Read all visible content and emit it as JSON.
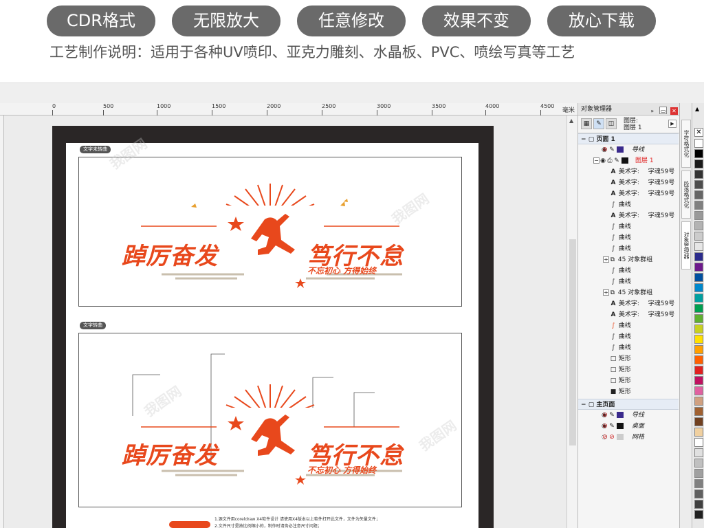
{
  "banner": {
    "pills": [
      "CDR格式",
      "无限放大",
      "任意修改",
      "效果不变",
      "放心下载"
    ],
    "craft_text": "工艺制作说明：适用于各种UV喷印、亚克力雕刻、水晶板、PVC、喷绘写真等工艺"
  },
  "ruler": {
    "ticks": [
      "0",
      "500",
      "1000",
      "1500",
      "2000",
      "2500",
      "3000",
      "3500",
      "4000",
      "4500"
    ],
    "unit": "毫米"
  },
  "canvas": {
    "tag_top": "文字未转曲",
    "tag_bottom": "文字转曲",
    "art": {
      "title_left": "踔厉奋发",
      "title_right": "笃行不怠",
      "subtitle": "不忘初心  方得始终"
    },
    "notes": [
      "1.源文件用coreldraw X4软件设计  请使用X4版本以上软件打开此文件，文件为矢量文件；",
      "2.文件尺寸是按比例缩小的，制作时请务必注意尺寸问题；"
    ]
  },
  "object_manager": {
    "title": "对象管理器",
    "layer_label": "图层:",
    "layer_value": "图层 1",
    "page1": "页面 1",
    "rows": [
      {
        "type": "layer",
        "name": "导线",
        "color": "#3a2a8c"
      },
      {
        "type": "layer",
        "name": "图层 1",
        "color": "#111111",
        "red": true
      },
      {
        "type": "text",
        "label": "美术字:",
        "value": "字魂59号"
      },
      {
        "type": "text",
        "label": "美术字:",
        "value": "字魂59号"
      },
      {
        "type": "text",
        "label": "美术字:",
        "value": "字魂59号"
      },
      {
        "type": "curve",
        "label": "曲线"
      },
      {
        "type": "text",
        "label": "美术字:",
        "value": "字魂59号"
      },
      {
        "type": "curve",
        "label": "曲线"
      },
      {
        "type": "curve",
        "label": "曲线"
      },
      {
        "type": "curve",
        "label": "曲线"
      },
      {
        "type": "group",
        "label": "45 对象群组"
      },
      {
        "type": "curve",
        "label": "曲线"
      },
      {
        "type": "curve",
        "label": "曲线"
      },
      {
        "type": "group",
        "label": "45 对象群组"
      },
      {
        "type": "text",
        "label": "美术字:",
        "value": "字魂59号"
      },
      {
        "type": "text",
        "label": "美术字:",
        "value": "字魂59号"
      },
      {
        "type": "curve",
        "label": "曲线"
      },
      {
        "type": "curve",
        "label": "曲线"
      },
      {
        "type": "curve",
        "label": "曲线"
      },
      {
        "type": "rect",
        "label": "矩形"
      },
      {
        "type": "rect",
        "label": "矩形"
      },
      {
        "type": "rect",
        "label": "矩形"
      },
      {
        "type": "rect",
        "label": "矩形"
      }
    ],
    "master_page": "主页面",
    "master_rows": [
      {
        "name": "导线",
        "color": "#3a2a8c"
      },
      {
        "name": "桌面",
        "color": "#111111"
      },
      {
        "name": "网格",
        "color": "#cccccc"
      }
    ]
  },
  "side_tabs": [
    "字符格式化",
    "段落格式化",
    "对象管理器"
  ],
  "palette": [
    "#ffffff",
    "#000000",
    "#1a1a1a",
    "#333333",
    "#4d4d4d",
    "#666666",
    "#808080",
    "#999999",
    "#b3b3b3",
    "#cccccc",
    "#e6e6e6",
    "#2b2b8c",
    "#6d1a8c",
    "#0050a0",
    "#0088cc",
    "#00a0a0",
    "#00a050",
    "#60b030",
    "#c8d020",
    "#ffe000",
    "#ffa000",
    "#ff6000",
    "#e02020",
    "#c01060",
    "#e060a0",
    "#d0a080",
    "#a06030",
    "#704020",
    "#f0d0a0",
    "#ffffff",
    "#e0e0e0",
    "#c0c0c0",
    "#a0a0a0",
    "#808080",
    "#606060",
    "#404040",
    "#202020"
  ]
}
